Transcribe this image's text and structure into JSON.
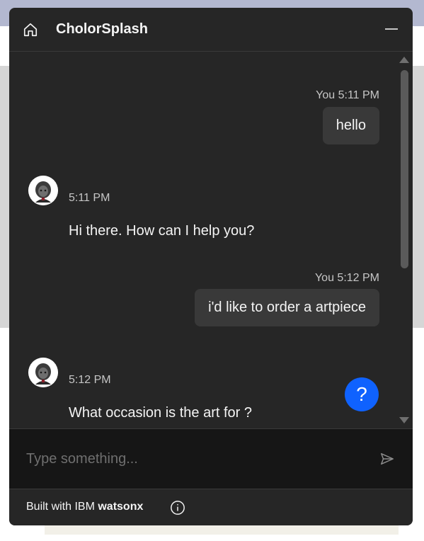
{
  "header": {
    "title": "CholorSplash",
    "home_icon": "home-icon",
    "minimize_icon": "minimize-icon"
  },
  "messages": [
    {
      "sender": "user",
      "meta": "You 5:11 PM",
      "text": "hello"
    },
    {
      "sender": "bot",
      "meta": "5:11 PM",
      "text": "Hi there. How can I help you?"
    },
    {
      "sender": "user",
      "meta": "You 5:12 PM",
      "text": "i'd like to order a artpiece"
    },
    {
      "sender": "bot",
      "meta": "5:12 PM",
      "text": "What occasion is the art for ?"
    }
  ],
  "help": {
    "label": "?"
  },
  "input": {
    "placeholder": "Type something...",
    "value": ""
  },
  "footer": {
    "prefix": "Built with IBM ",
    "brand": "watsonx",
    "info_icon": "info-icon"
  },
  "colors": {
    "panel": "#262626",
    "input_bg": "#161616",
    "bubble": "#393939",
    "accent": "#0f62fe",
    "text": "#f4f4f4",
    "muted": "#c6c6c6"
  }
}
